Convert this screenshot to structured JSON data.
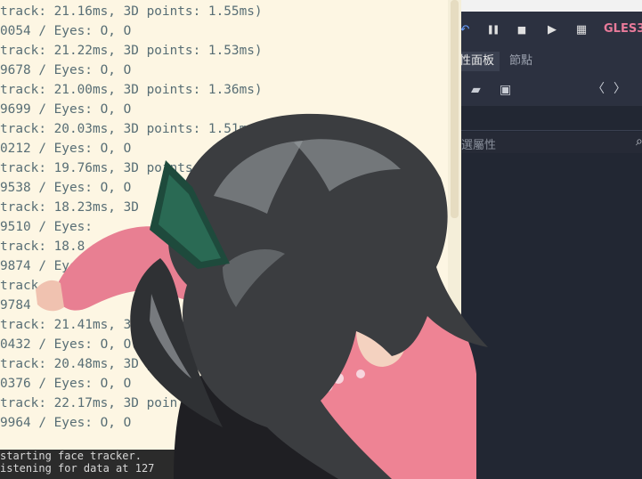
{
  "terminal": {
    "lines": [
      "track: 21.16ms, 3D points: 1.55ms)",
      "0054 / Eyes: O, O",
      "track: 21.22ms, 3D points: 1.53ms)",
      "9678 / Eyes: O, O",
      "track: 21.00ms, 3D points: 1.36ms)",
      "9699 / Eyes: O, O",
      "track: 20.03ms, 3D points: 1.51ms)",
      "0212 / Eyes: O, O",
      "track: 19.76ms, 3D points:",
      "9538 / Eyes: O, O",
      "track: 18.23ms, 3D",
      "9510 / Eyes:",
      "track: 18.8",
      "9874 / Eye",
      "track",
      "9784",
      "track: 21.41ms, 3D",
      "0432 / Eyes: O, O",
      "track: 20.48ms, 3D point",
      "0376 / Eyes: O, O",
      "track: 22.17ms, 3D poin",
      "9964 / Eyes: O, O"
    ],
    "bottom_lines": [
      "starting face tracker.",
      "istening for data at 127"
    ]
  },
  "editor": {
    "renderer": "GLES3",
    "tabs": [
      "性面板",
      "節點"
    ],
    "filter_placeholder": "選屬性"
  },
  "icons": {
    "undo": "↶",
    "pause": "❚❚",
    "stop": "■",
    "movie": "▶",
    "film": "▦",
    "folder": "▰",
    "save": "▣",
    "prev": "〈",
    "next": "〉",
    "search": "⌕"
  }
}
